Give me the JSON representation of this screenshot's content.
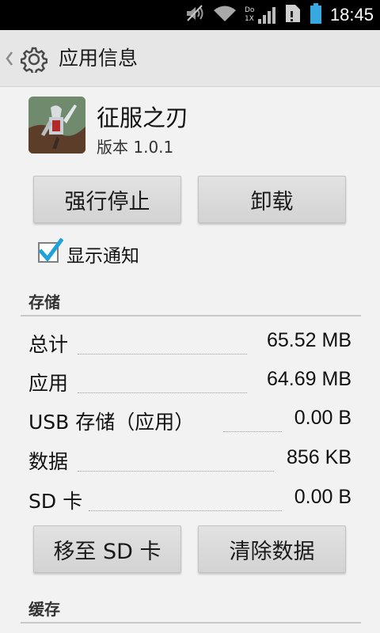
{
  "status_bar": {
    "time": "18:45",
    "network_label_top": "Do",
    "network_label_bottom": "1X",
    "icons": [
      "mute-icon",
      "wifi-icon",
      "cell-signal-icon",
      "sim-icon",
      "battery-icon"
    ]
  },
  "action_bar": {
    "title": "应用信息",
    "icon": "gear-icon"
  },
  "app": {
    "name": "征服之刃",
    "version": "版本 1.0.1"
  },
  "buttons": {
    "force_stop": "强行停止",
    "uninstall": "卸载",
    "move_to_sd": "移至 SD 卡",
    "clear_data": "清除数据"
  },
  "notification": {
    "label": "显示通知",
    "checked": true
  },
  "storage": {
    "header": "存储",
    "rows": [
      {
        "label": "总计",
        "value": "65.52 MB"
      },
      {
        "label": "应用",
        "value": "64.69 MB"
      },
      {
        "label": "USB 存储（应用）",
        "value": "0.00 B"
      },
      {
        "label": "数据",
        "value": "856 KB"
      },
      {
        "label": "SD 卡",
        "value": "0.00 B"
      }
    ]
  },
  "cache": {
    "header": "缓存"
  },
  "colors": {
    "checkbox_accent": "#1ea2db",
    "status_bar_bg": "#000000",
    "battery": "#38a8e0"
  }
}
